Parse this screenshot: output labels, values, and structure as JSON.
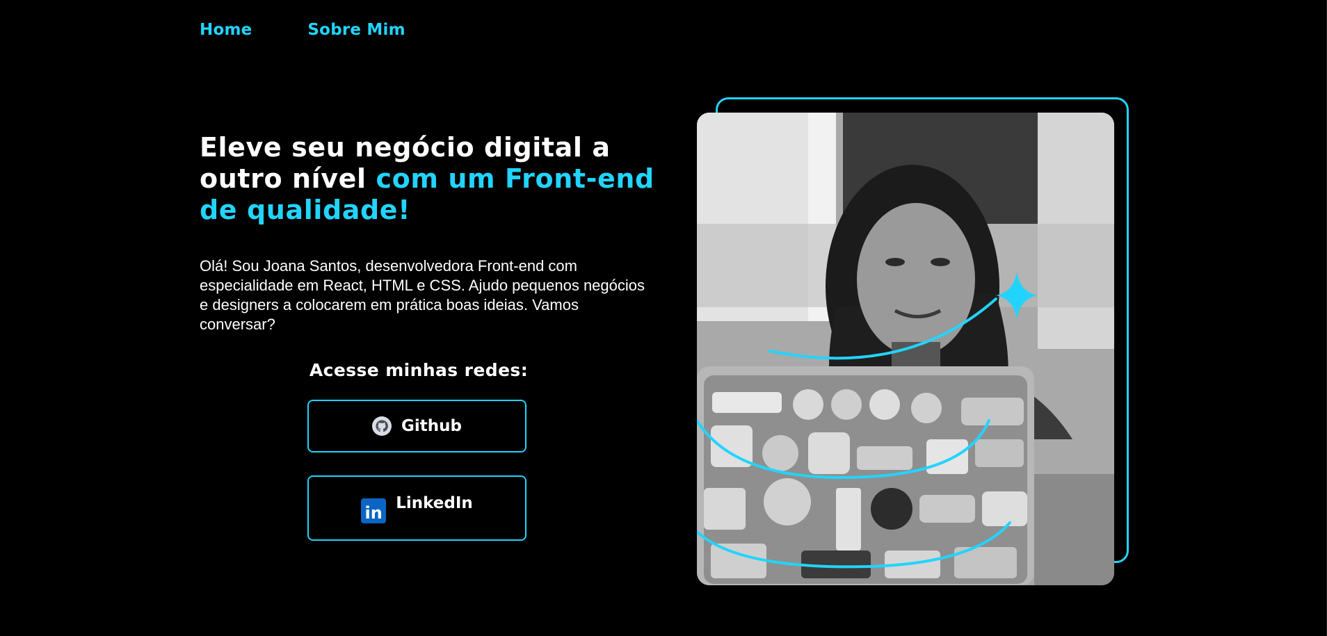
{
  "nav": {
    "items": [
      {
        "label": "Home"
      },
      {
        "label": "Sobre Mim"
      }
    ]
  },
  "hero": {
    "title_white": "Eleve seu negócio digital a outro nível ",
    "title_accent": "com um Front-end de qualidade!",
    "text": "Olá! Sou Joana Santos, desenvolvedora Front-end com especialidade em React, HTML e CSS. Ajudo pequenos negócios e designers a colocarem em prática boas ideias. Vamos conversar?"
  },
  "social": {
    "title": "Acesse minhas redes:",
    "buttons": [
      {
        "label": "Github",
        "icon": "github-icon"
      },
      {
        "label": "LinkedIn",
        "icon": "linkedin-icon"
      }
    ]
  },
  "portrait": {
    "alt": "portrait-photo",
    "decoration_icon": "sparkle-icon"
  },
  "colors": {
    "background": "#000000",
    "accent": "#22d4fd",
    "text": "#ffffff",
    "linkedin": "#0a66c2"
  }
}
